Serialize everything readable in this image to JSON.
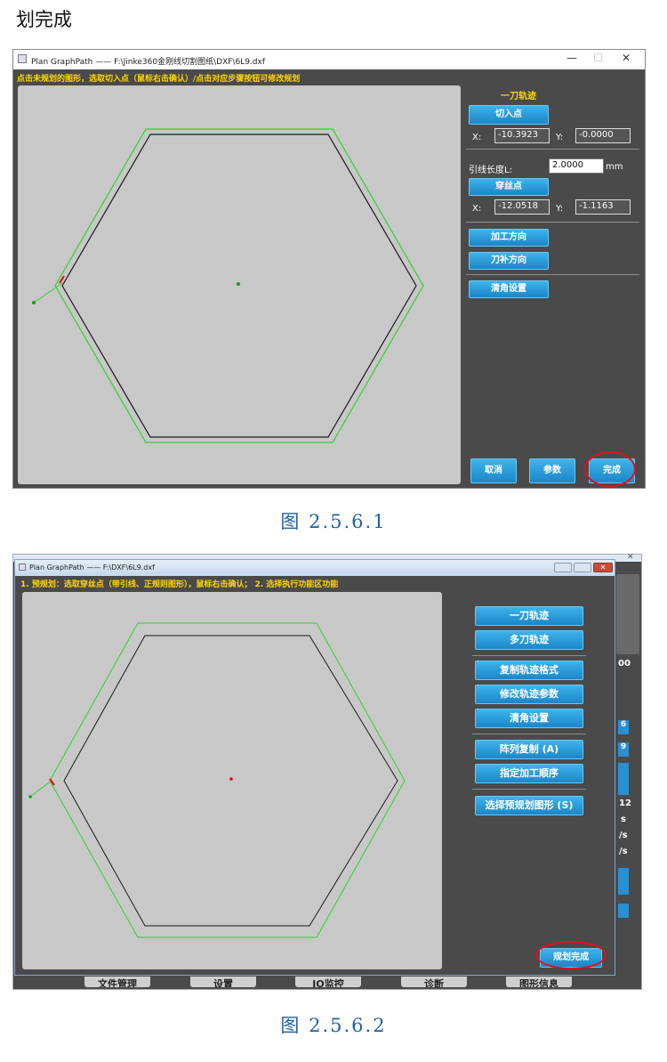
{
  "heading": "划完成",
  "window1": {
    "title": "Plan GraphPath —— F:\\Jinke360金刚线切割图纸\\DXF\\6L9.dxf",
    "hint": "点击未规划的图形，选取切入点（鼠标右击确认）/点击对应步骤按钮可修改规划",
    "controls": {
      "min": "—",
      "max": "☐",
      "close": "✕"
    },
    "panel": {
      "title": "一刀轨迹",
      "entry_point_button": "切入点",
      "entry_x_label": "X:",
      "entry_x_value": "-10.3923",
      "entry_y_label": "Y:",
      "entry_y_value": "-0.0000",
      "lead_length_label": "引线长度L:",
      "lead_length_value": "2.0000",
      "lead_length_unit": "mm",
      "thread_point_button": "穿丝点",
      "thread_x_label": "X:",
      "thread_x_value": "-12.0518",
      "thread_y_label": "Y:",
      "thread_y_value": "-1.1163",
      "direction_button": "加工方向",
      "compensation_button": "刀补方向",
      "corner_button": "清角设置"
    },
    "bottom": {
      "cancel": "取消",
      "params": "参数",
      "done": "完成"
    }
  },
  "caption1": "图 2.5.6.1",
  "window2": {
    "title": "Plan GraphPath —— F:\\DXF\\6L9.dxf",
    "hint": "1. 预规划：选取穿丝点（带引线、正规则图形），鼠标右击确认；  2. 选择执行功能区功能",
    "buttons": [
      "一刀轨迹",
      "多刀轨迹",
      "复制轨迹格式",
      "修改轨迹参数",
      "清角设置",
      "阵列复制 (A)",
      "指定加工顺序",
      "选择预规划图形 (S)"
    ],
    "finish_button": "规划完成",
    "background_fragments": [
      "00",
      "6",
      "9",
      "12",
      "s",
      "/s",
      "/s"
    ],
    "background_tabs": [
      "文件管理",
      "设置",
      "IO监控",
      "诊断",
      "图形信息"
    ]
  },
  "caption2": "图 2.5.6.2",
  "colors": {
    "accent": "#1b86c8",
    "hint": "#ffd700",
    "highlight": "#e0101e",
    "path": "#2fd12f"
  }
}
